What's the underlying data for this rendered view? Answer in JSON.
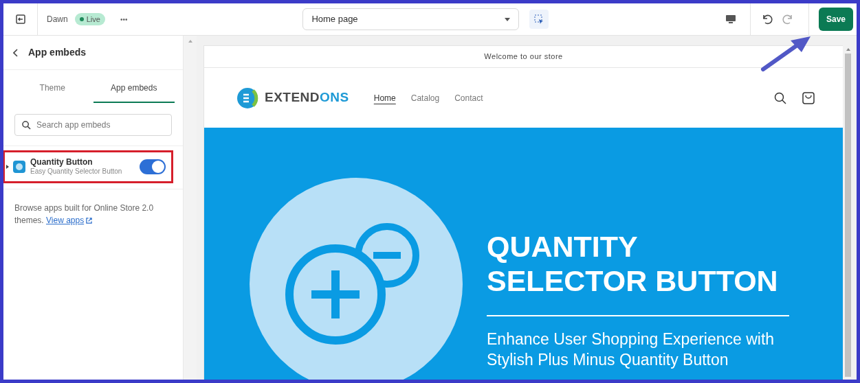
{
  "topbar": {
    "theme_name": "Dawn",
    "status_badge": "Live",
    "more": "•••",
    "page_select": "Home page",
    "save_button": "Save"
  },
  "sidebar": {
    "title": "App embeds",
    "tabs": [
      {
        "label": "Theme",
        "selected": false
      },
      {
        "label": "App embeds",
        "selected": true
      }
    ],
    "search": {
      "placeholder": "Search app embeds"
    },
    "apps": [
      {
        "name": "Quantity Button",
        "subtitle": "Easy Quantity Selector Button",
        "enabled": true,
        "highlighted": true
      }
    ],
    "note": "Browse apps built for Online Store 2.0 themes.",
    "note_link": "View apps"
  },
  "preview": {
    "announcement": "Welcome to our store",
    "logo_parts": [
      {
        "text": "EXTEND",
        "color": "#4a4a4a"
      },
      {
        "text": "ONS",
        "color": "#1e9ad6"
      }
    ],
    "nav": [
      {
        "label": "Home",
        "selected": true
      },
      {
        "label": "Catalog",
        "selected": false
      },
      {
        "label": "Contact",
        "selected": false
      }
    ],
    "hero": {
      "title_lines": [
        "QUANTITY",
        "SELECTOR BUTTON"
      ],
      "subtitle_lines": [
        "Enhance User Shopping Experience with",
        "Stylish Plus Minus Quantity Button"
      ]
    }
  },
  "annotation": {
    "arrow_to_save": true
  }
}
